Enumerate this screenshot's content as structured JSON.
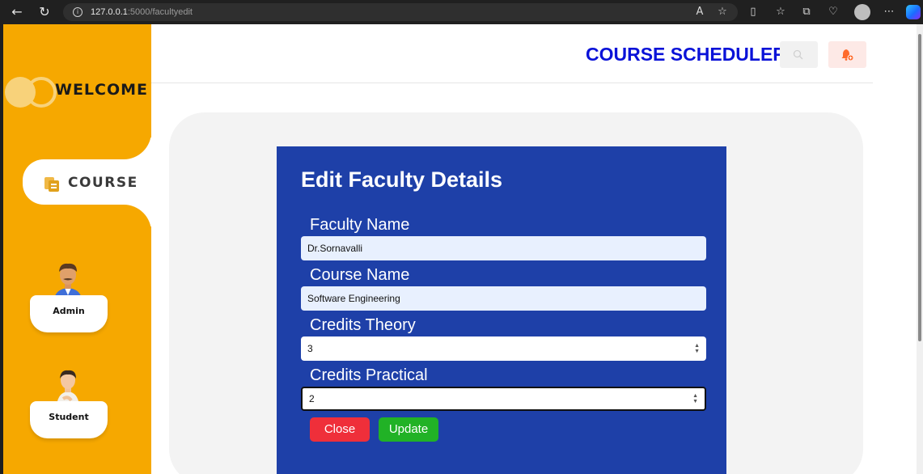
{
  "browser": {
    "url_host": "127.0.0.1",
    "url_path": ":5000/facultyedit"
  },
  "app": {
    "title": "COURSE SCHEDULER"
  },
  "sidebar": {
    "welcome_label": "WELCOME",
    "course_label": "COURSE",
    "roles": [
      {
        "label": "Admin"
      },
      {
        "label": "Student"
      }
    ]
  },
  "form": {
    "title": "Edit Faculty Details",
    "fields": [
      {
        "label": "Faculty Name",
        "value": "Dr.Sornavalli"
      },
      {
        "label": "Course Name",
        "value": "Software Engineering"
      },
      {
        "label": "Credits Theory",
        "value": "3"
      },
      {
        "label": "Credits Practical",
        "value": "2"
      }
    ],
    "close_label": "Close",
    "update_label": "Update"
  },
  "colors": {
    "sidebar": "#f6a800",
    "form_panel": "#1e40a8",
    "brand": "#0a12d8",
    "close_button": "#ef2f3a",
    "update_button": "#21b226"
  },
  "icons": {
    "back": "back-arrow-icon",
    "reload": "reload-icon",
    "info": "info-icon",
    "search": "search-icon",
    "bell": "bell-icon",
    "course": "course-icon"
  }
}
